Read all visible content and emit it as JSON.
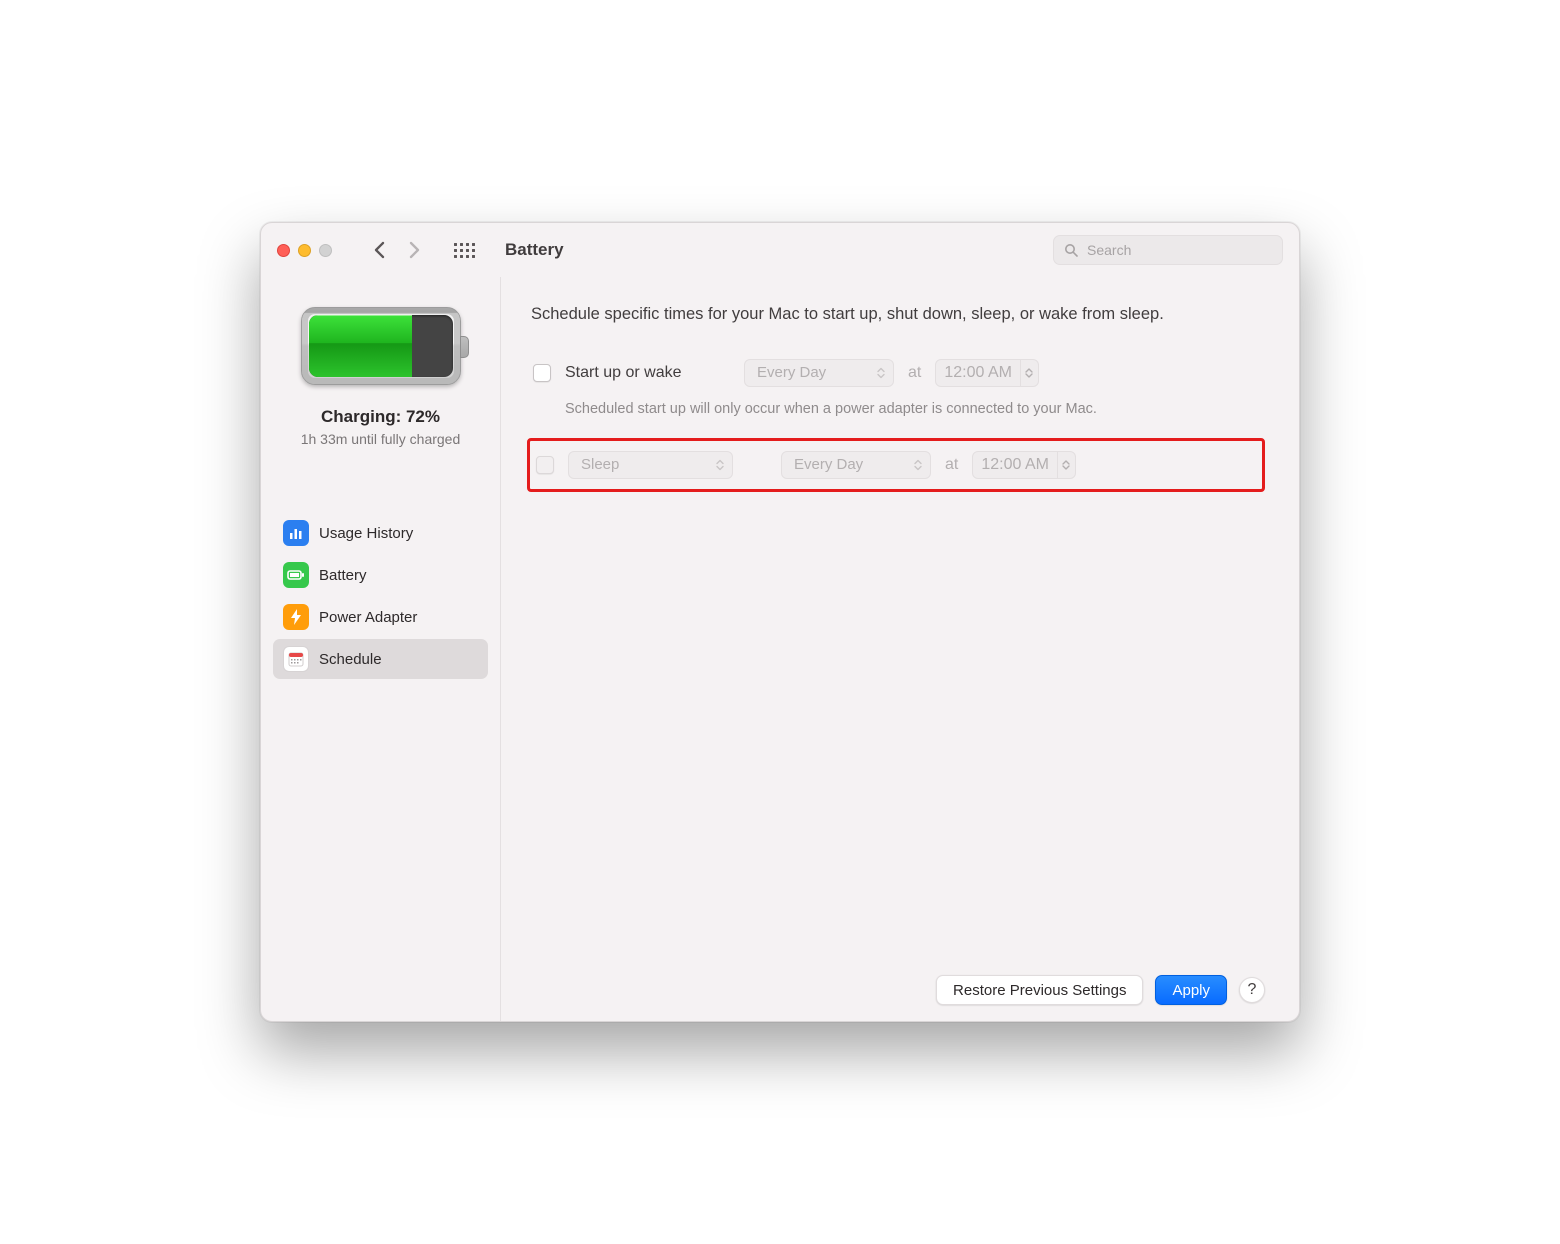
{
  "window": {
    "title": "Battery",
    "search_placeholder": "Search"
  },
  "sidebar": {
    "charging_label": "Charging: 72%",
    "time_remaining": "1h 33m until fully charged",
    "items": [
      {
        "label": "Usage History"
      },
      {
        "label": "Battery"
      },
      {
        "label": "Power Adapter"
      },
      {
        "label": "Schedule"
      }
    ]
  },
  "content": {
    "intro": "Schedule specific times for your Mac to start up, shut down, sleep, or wake from sleep.",
    "row1": {
      "label": "Start up or wake",
      "frequency": "Every Day",
      "at_label": "at",
      "time": "12:00 AM",
      "hint": "Scheduled start up will only occur when a power adapter is connected to your Mac."
    },
    "row2": {
      "action": "Sleep",
      "frequency": "Every Day",
      "at_label": "at",
      "time": "12:00 AM"
    }
  },
  "footer": {
    "restore": "Restore Previous Settings",
    "apply": "Apply",
    "help": "?"
  }
}
